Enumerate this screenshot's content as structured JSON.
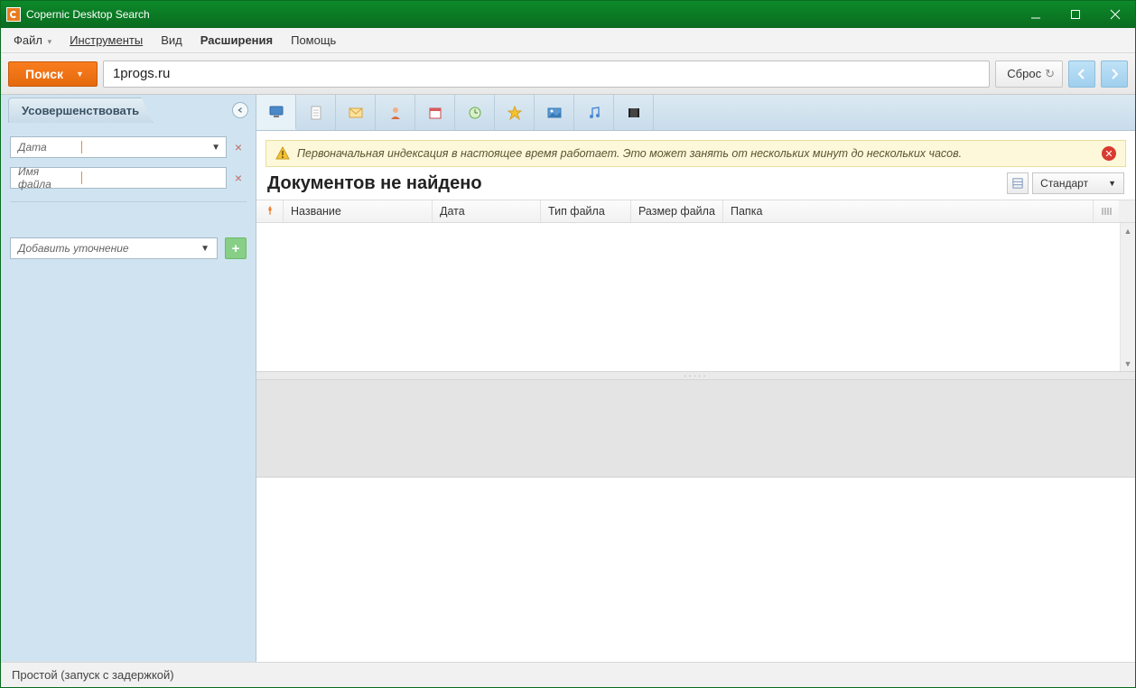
{
  "titlebar": {
    "title": "Copernic Desktop Search"
  },
  "menu": {
    "file": "Файл",
    "tools": "Инструменты",
    "view": "Вид",
    "extensions": "Расширения",
    "help": "Помощь"
  },
  "search": {
    "button_label": "Поиск",
    "value": "1progs.ru",
    "reset_label": "Сброс"
  },
  "sidebar": {
    "refine_title": "Усовершенствовать",
    "date_label": "Дата",
    "filename_label": "Имя файла",
    "add_label": "Добавить уточнение"
  },
  "categories": {
    "all": "all",
    "docs": "documents",
    "mail": "mail",
    "contacts": "contacts",
    "calendar": "calendar",
    "history": "history",
    "favorites": "favorites",
    "pictures": "pictures",
    "music": "music",
    "video": "video"
  },
  "alert": {
    "text": "Первоначальная индексация в настоящее время работает. Это может занять от нескольких минут до нескольких часов."
  },
  "results": {
    "title": "Документов не найдено",
    "view_label": "Стандарт"
  },
  "columns": {
    "name": "Название",
    "date": "Дата",
    "filetype": "Тип файла",
    "filesize": "Размер файла",
    "folder": "Папка"
  },
  "status": {
    "text": "Простой (запуск с задержкой)"
  }
}
